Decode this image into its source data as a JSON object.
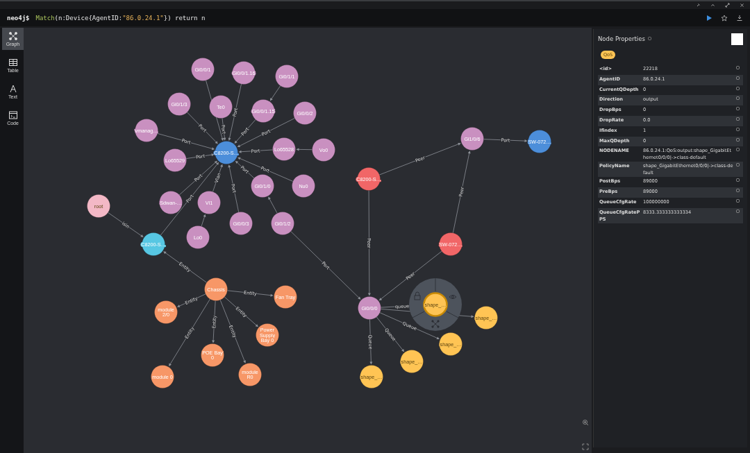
{
  "query_bar": {
    "prompt": "neo4j$",
    "tokens": [
      {
        "kind": "keyword",
        "text": "Match"
      },
      {
        "kind": "plain",
        "text": "(n:Device{AgentID:"
      },
      {
        "kind": "string",
        "text": "\"86.0.24.1\""
      },
      {
        "kind": "plain",
        "text": "}) return n"
      }
    ]
  },
  "sidebar": {
    "items": [
      {
        "label": "Graph",
        "kind": "graph",
        "selected": true
      },
      {
        "label": "Table",
        "kind": "table",
        "selected": false
      },
      {
        "label": "Text",
        "kind": "text",
        "selected": false
      },
      {
        "label": "Code",
        "kind": "code",
        "selected": false
      }
    ]
  },
  "graph": {
    "nodes": [
      {
        "label": [
          "Gi0/0/1"
        ],
        "color": "#c990c0",
        "selected": false
      },
      {
        "label": [
          "Gi0/0/1.16"
        ],
        "color": "#c990c0",
        "selected": false
      },
      {
        "label": [
          "Gi0/1/1"
        ],
        "color": "#c990c0",
        "selected": false
      },
      {
        "label": [
          "Gi0/1/3"
        ],
        "color": "#c990c0",
        "selected": false
      },
      {
        "label": [
          "Te0"
        ],
        "color": "#c990c0",
        "selected": false
      },
      {
        "label": [
          "Gi0/0/1.15"
        ],
        "color": "#c990c0",
        "selected": false
      },
      {
        "label": [
          "Gi0/0/2"
        ],
        "color": "#c990c0",
        "selected": false
      },
      {
        "label": [
          "vmanag…"
        ],
        "color": "#c990c0",
        "selected": false
      },
      {
        "label": [
          "Lo65528"
        ],
        "color": "#c990c0",
        "selected": false
      },
      {
        "label": [
          "Vo0"
        ],
        "color": "#c990c0",
        "selected": false
      },
      {
        "label": [
          "Lo65529"
        ],
        "color": "#c990c0",
        "selected": false
      },
      {
        "label": [
          "Nu0"
        ],
        "color": "#c990c0",
        "selected": false
      },
      {
        "label": [
          "Gi0/1/0"
        ],
        "color": "#c990c0",
        "selected": false
      },
      {
        "label": [
          "Vl1"
        ],
        "color": "#c990c0",
        "selected": false
      },
      {
        "label": [
          "Sdwan-…"
        ],
        "color": "#c990c0",
        "selected": false
      },
      {
        "label": [
          "Lo0"
        ],
        "color": "#c990c0",
        "selected": false
      },
      {
        "label": [
          "Gi0/0/3"
        ],
        "color": "#c990c0",
        "selected": false
      },
      {
        "label": [
          "Gi0/1/2"
        ],
        "color": "#c990c0",
        "selected": false
      },
      {
        "label": [
          "C8200-S…"
        ],
        "color": "#4c8eda",
        "selected": false
      },
      {
        "label": [
          "root"
        ],
        "color": "#f3b8c6",
        "selected": false
      },
      {
        "label": [
          "C8200-S…"
        ],
        "color": "#57c7e3",
        "selected": false
      },
      {
        "label": [
          "Chassis"
        ],
        "color": "#f79767",
        "selected": false
      },
      {
        "label": [
          "Fan Tray"
        ],
        "color": "#f79767",
        "selected": false
      },
      {
        "label": [
          "module",
          "2/0"
        ],
        "color": "#f79767",
        "selected": false
      },
      {
        "label": [
          "Power",
          "Supply",
          "Bay 0"
        ],
        "color": "#f79767",
        "selected": false
      },
      {
        "label": [
          "POE Bay",
          "0"
        ],
        "color": "#f79767",
        "selected": false
      },
      {
        "label": [
          "module 0"
        ],
        "color": "#f79767",
        "selected": false
      },
      {
        "label": [
          "module",
          "R0"
        ],
        "color": "#f79767",
        "selected": false
      },
      {
        "label": [
          "Gi1/0/6"
        ],
        "color": "#c990c0",
        "selected": false
      },
      {
        "label": [
          "SW-072…"
        ],
        "color": "#4c8eda",
        "selected": false
      },
      {
        "label": [
          "C8200-S…"
        ],
        "color": "#f16667",
        "selected": false
      },
      {
        "label": [
          "SW-072…"
        ],
        "color": "#f16667",
        "selected": false
      },
      {
        "label": [
          "Gi0/0/0"
        ],
        "color": "#c990c0",
        "selected": false
      },
      {
        "label": [
          "shape_…"
        ],
        "color": "#ffc454",
        "selected": true
      },
      {
        "label": [
          "shape_…"
        ],
        "color": "#ffc454",
        "selected": false
      },
      {
        "label": [
          "shape_…"
        ],
        "color": "#ffc454",
        "selected": false
      },
      {
        "label": [
          "shape_…"
        ],
        "color": "#ffc454",
        "selected": false
      },
      {
        "label": [
          "shape_…"
        ],
        "color": "#ffc454",
        "selected": false
      }
    ],
    "edge_labels": [
      "Port",
      "Port",
      "Port",
      "Port",
      "Port",
      "Port",
      "Port",
      "Port",
      "Port",
      "Port",
      "Vlan",
      "Port",
      "Port",
      "Port",
      "isin",
      "Entity",
      "Entity",
      "Entity",
      "Entity",
      "Entity",
      "Entity",
      "Entity",
      "Port",
      "Peer",
      "Peer",
      "Peer",
      "Peer",
      "Port",
      "queue",
      "Queue",
      "Queue",
      "Queue"
    ]
  },
  "properties": {
    "title": "Node Properties",
    "badge": "QoS",
    "rows": [
      {
        "key": "<id>",
        "value": "22218"
      },
      {
        "key": "AgentID",
        "value": "86.0.24.1"
      },
      {
        "key": "CurrentQDepth",
        "value": "0"
      },
      {
        "key": "Direction",
        "value": "output"
      },
      {
        "key": "DropBps",
        "value": "0"
      },
      {
        "key": "DropRate",
        "value": "0.0"
      },
      {
        "key": "Ifindex",
        "value": "1"
      },
      {
        "key": "MaxQDepth",
        "value": "0"
      },
      {
        "key": "NODENAME",
        "value": "86.0.24.1:QoS:output:shape_GigabitEthernet0/0/0|->class-default"
      },
      {
        "key": "PolicyName",
        "value": "shape_GigabitEthernet0/0/0|->class-default"
      },
      {
        "key": "PostBps",
        "value": "89000"
      },
      {
        "key": "PreBps",
        "value": "89000"
      },
      {
        "key": "QueueCfgRate",
        "value": "100000000"
      },
      {
        "key": "QueueCfgRatePPS",
        "value": "8333.333333333334"
      }
    ]
  }
}
